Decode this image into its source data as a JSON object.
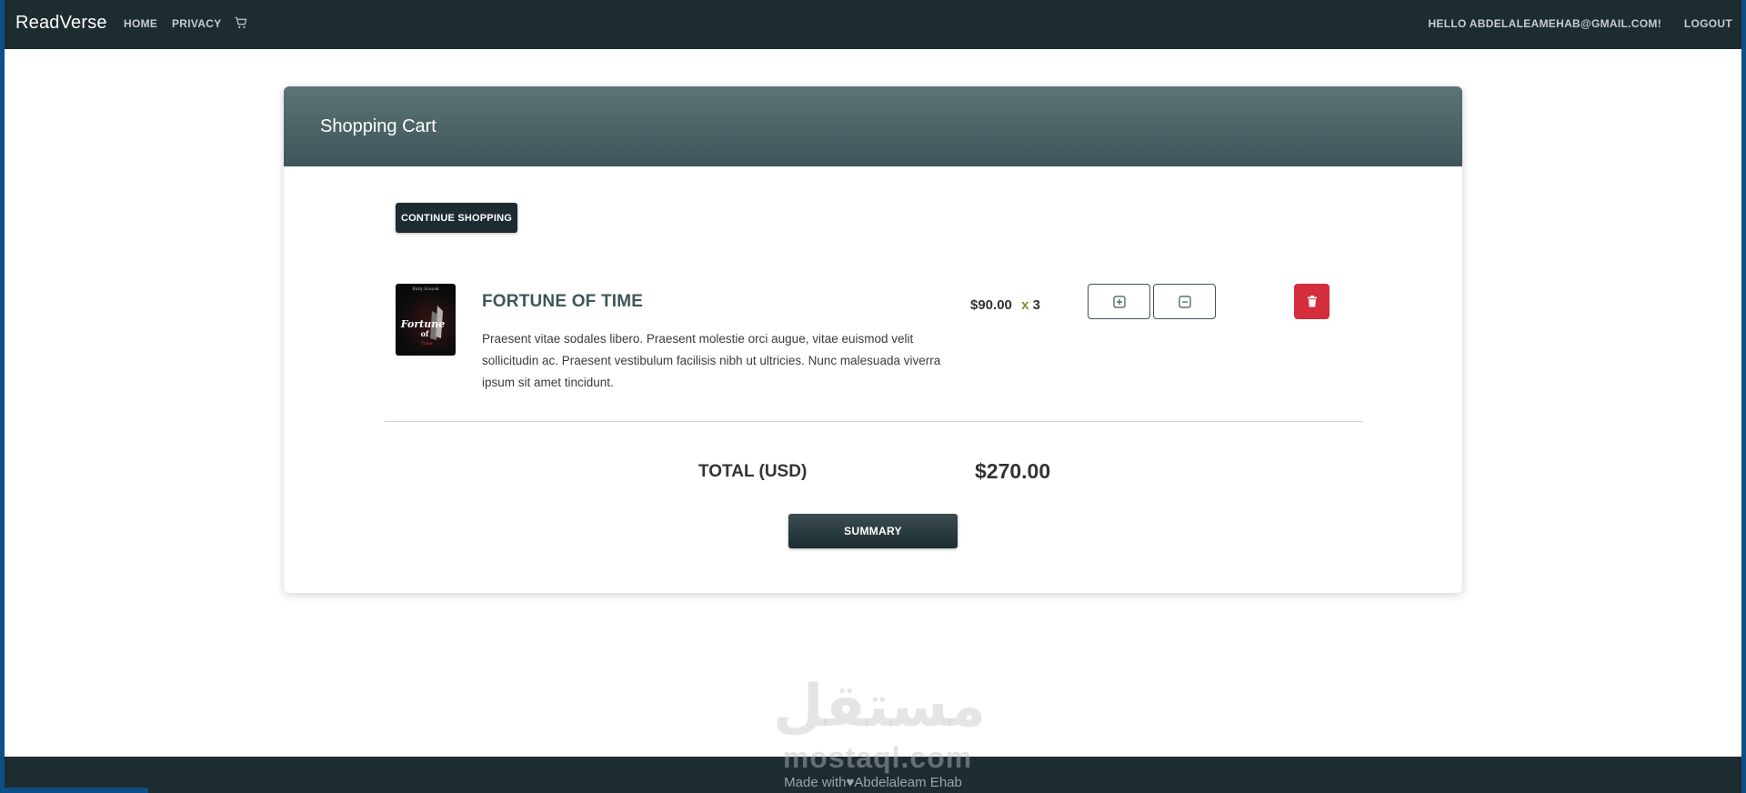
{
  "navbar": {
    "brand": "ReadVerse",
    "links": [
      "HOME",
      "PRIVACY"
    ],
    "cart_icon": "cart-icon",
    "greeting": "HELLO ABDELALEAMEHAB@GMAIL.COM!",
    "logout": "LOGOUT"
  },
  "cart": {
    "title": "Shopping Cart",
    "continue_label": "CONTINUE SHOPPING",
    "items": [
      {
        "title": "FORTUNE OF TIME",
        "description": "Praesent vitae sodales libero. Praesent molestie orci augue, vitae euismod velit sollicitudin ac. Praesent vestibulum facilisis nibh ut ultricies. Nunc malesuada viverra ipsum sit amet tincidunt.",
        "price": "$90.00",
        "times": "x",
        "quantity": "3",
        "cover_text_top": "Ruby Scayak",
        "cover_text_main": "Fortune",
        "cover_text_of": "of",
        "cover_text_bottom": "Time"
      }
    ],
    "total_label": "TOTAL (USD)",
    "total_value": "$270.00",
    "summary_label": "SUMMARY"
  },
  "watermark": {
    "arabic": "مستقل",
    "latin": "mostaql.com"
  },
  "footer": {
    "prefix": "Made with",
    "heart": "♥",
    "author": "Abdelaleam Ehab"
  },
  "colors": {
    "navbar": "#1c2c31",
    "header_gradient_top": "#5c7476",
    "header_gradient_bottom": "#3e5559",
    "title_text": "#3f5659",
    "delete_red": "#d42d3c",
    "page_border": "#0d4f86"
  }
}
